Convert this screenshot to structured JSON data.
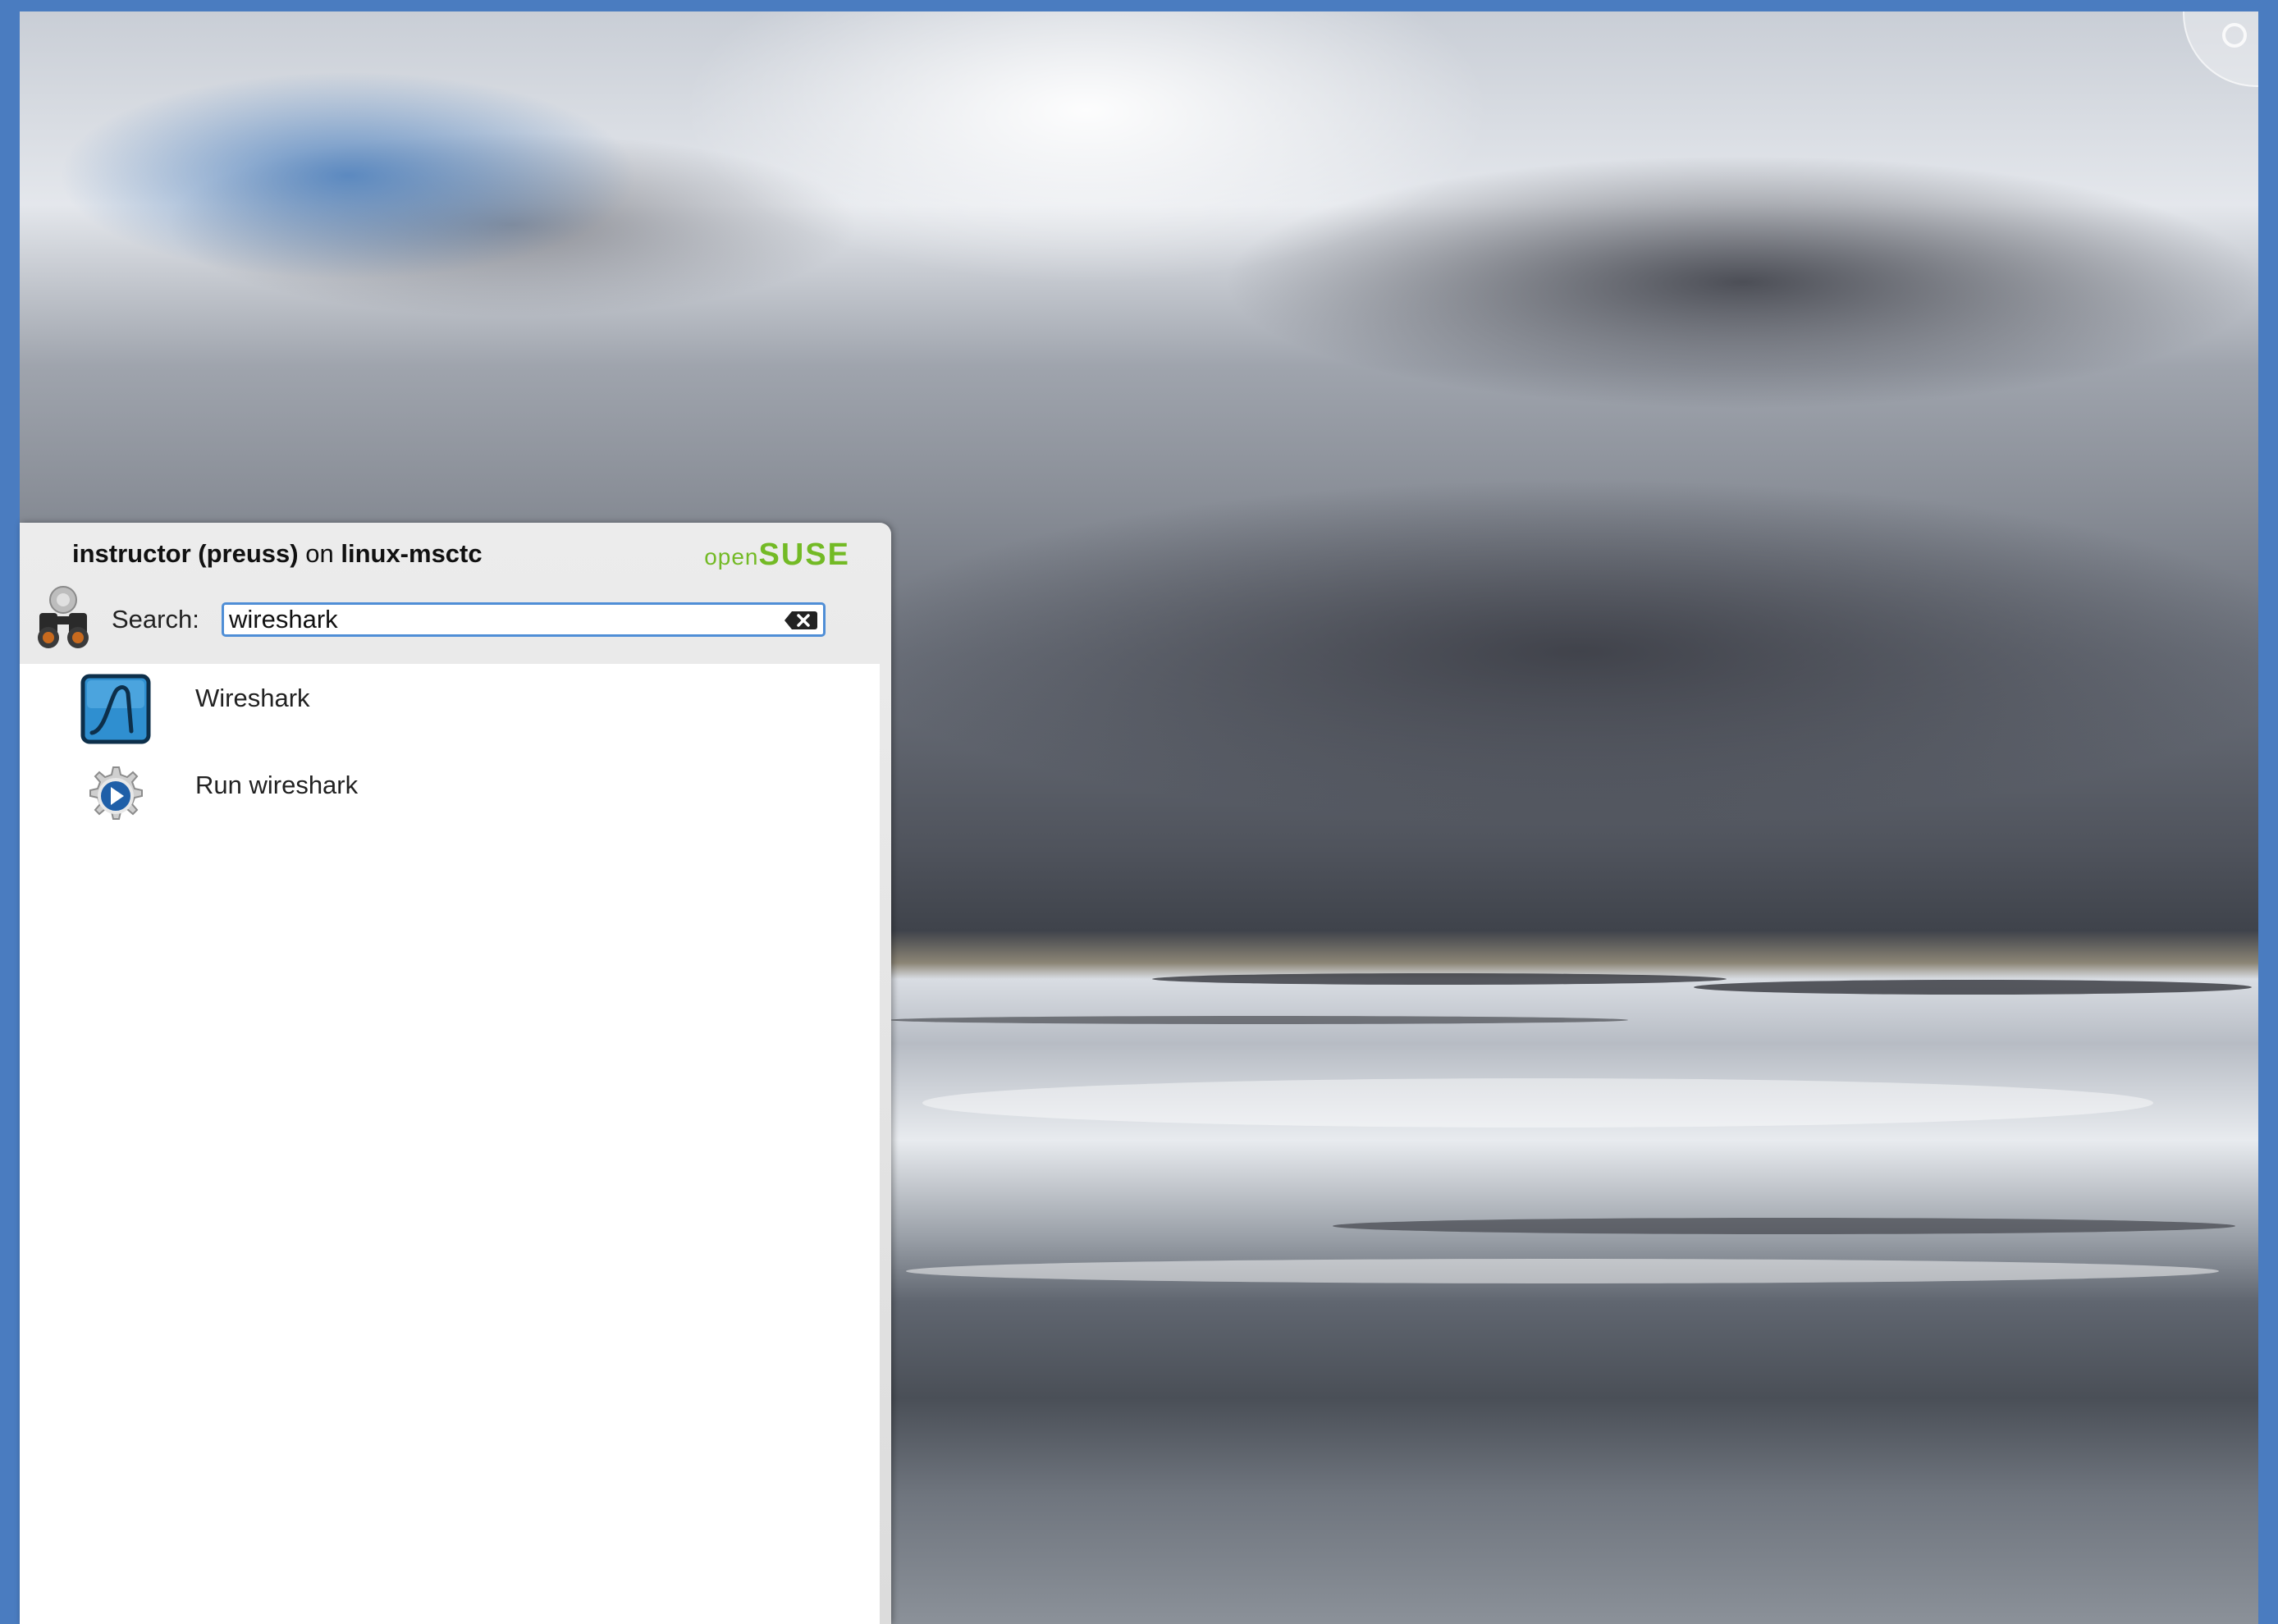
{
  "launcher": {
    "user": "instructor (preuss)",
    "on_word": "on",
    "host": "linux-msctc",
    "brand_open": "open",
    "brand_suse": "SUSE",
    "search_label": "Search:",
    "search_value": "wireshark",
    "results": [
      {
        "label": "Wireshark",
        "icon": "wireshark-icon"
      },
      {
        "label": "Run wireshark",
        "icon": "run-command-icon"
      }
    ]
  },
  "colors": {
    "brand_green": "#73ba25",
    "search_focus": "#4f8ed6",
    "frame_blue": "#4a7cc0"
  }
}
